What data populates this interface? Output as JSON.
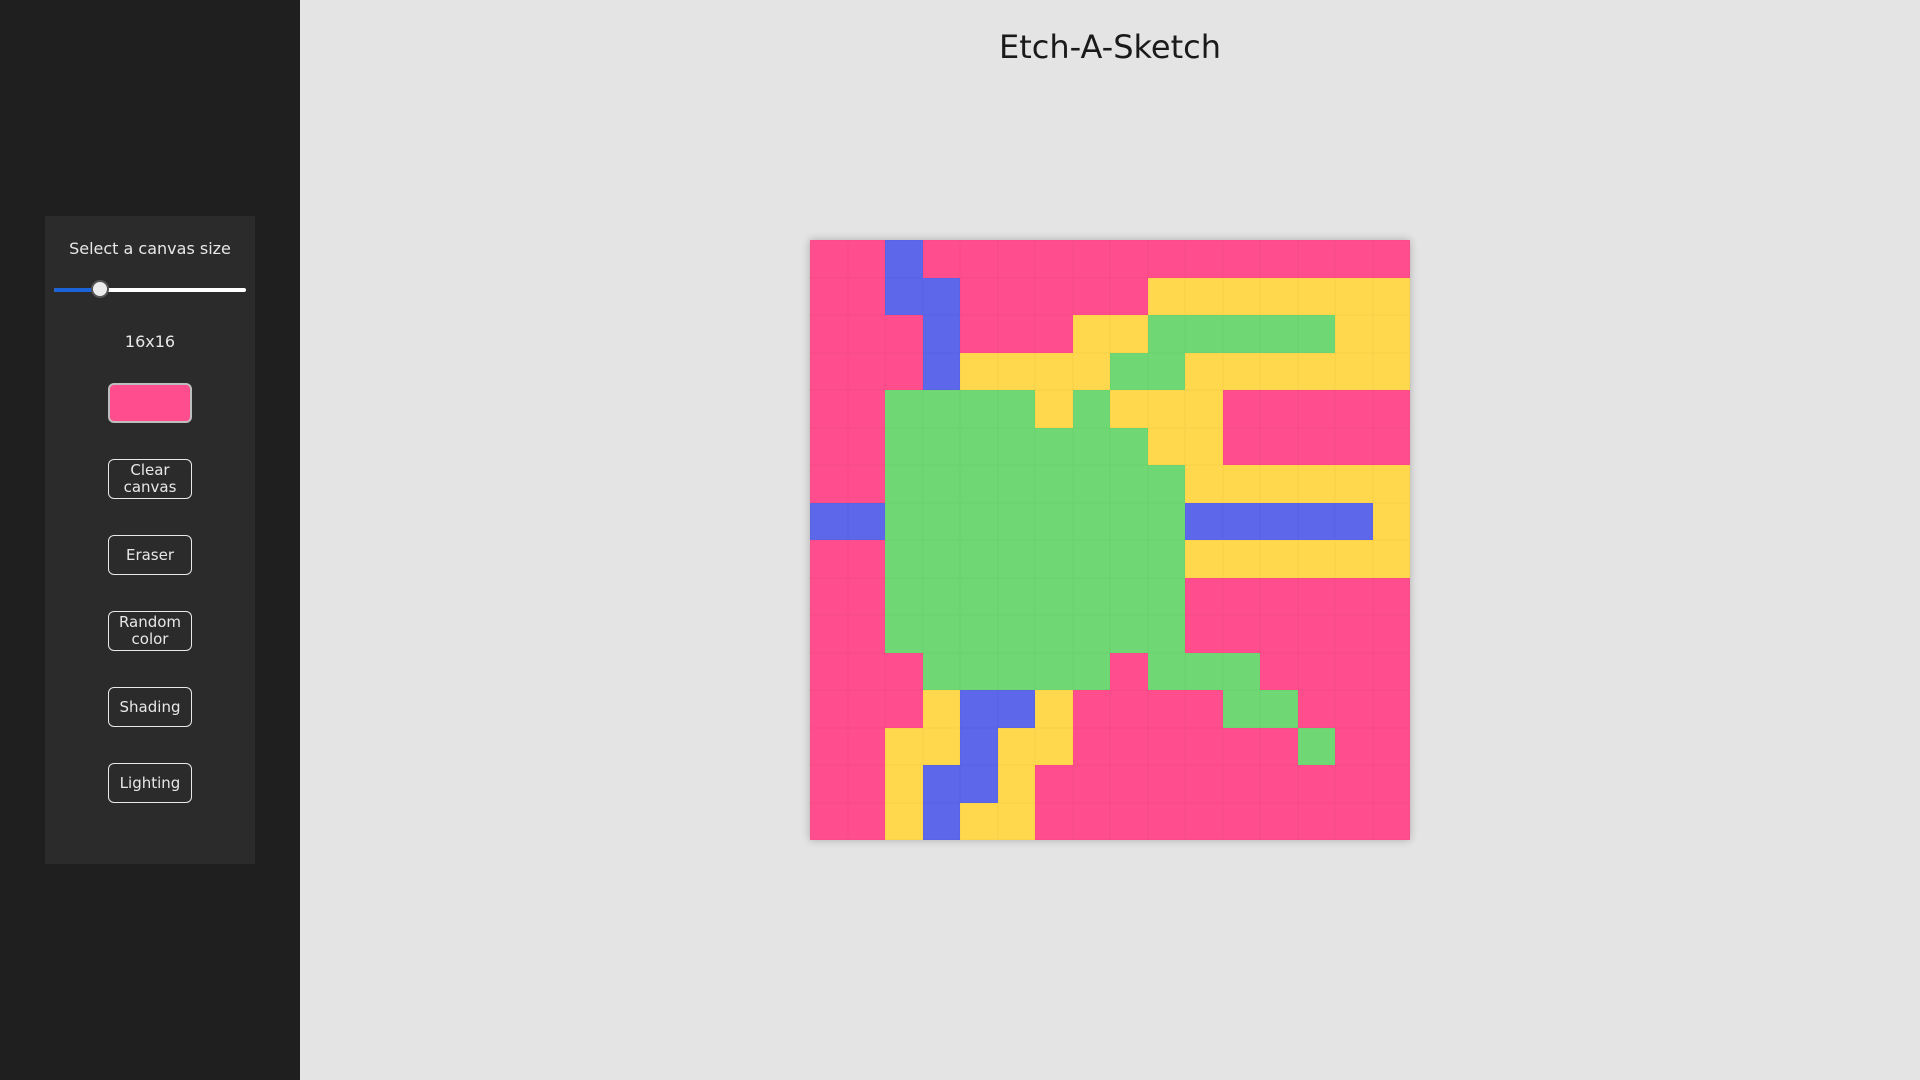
{
  "title": "Etch-A-Sketch",
  "sidebar": {
    "canvas_size_label": "Select a canvas size",
    "slider_value": 16,
    "slider_min": 1,
    "slider_max": 64,
    "size_display": "16x16",
    "current_color": "#ff4d8d",
    "buttons": {
      "clear": "Clear canvas",
      "eraser": "Eraser",
      "random": "Random color",
      "shading": "Shading",
      "lighting": "Lighting"
    }
  },
  "colors": {
    "P": "#ff4d8d",
    "B": "#5c67ea",
    "Y": "#ffd84d",
    "G": "#6fd874"
  },
  "grid": {
    "size": 16,
    "rows": [
      "PPBPPPPPPPPPPPPP",
      "PPBBPPPPPYYYYYYY",
      "PPPBPPPYYGGGGGYY",
      "PPPBYYYYGGYYYYYY",
      "PPGGGGYGYYYPPPPP",
      "PPGGGGGGGYYPPPPP",
      "PPGGGGGGGGYYYYYY",
      "BBGGGGGGGGBBBBBY",
      "PPGGGGGGGGYYYYYY",
      "PPGGGGGGGGPPPPPP",
      "PPGGGGGGGGPPPPPP",
      "PPPGGGGGPGGGPPPP",
      "PPPYBBYPPPPGGPPP",
      "PPYYBYYPPPPPPGPP",
      "PPYBBYPPPPPPPPPP",
      "PPYBYYPPPPPPPPPP"
    ]
  }
}
